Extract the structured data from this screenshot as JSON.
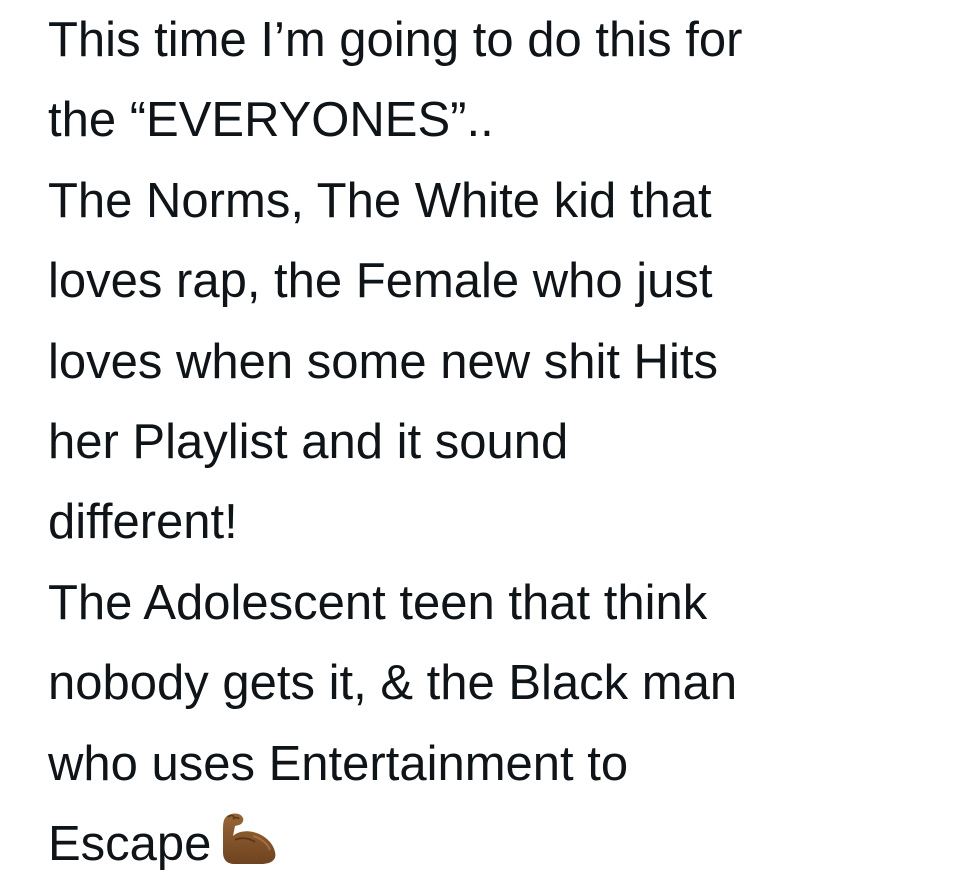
{
  "tweet": {
    "lines": [
      "This time I’m going to do this for",
      "the “EVERYONES”..",
      "The Norms, The White kid that",
      "loves rap, the Female who just",
      "loves when some new shit Hits",
      "her Playlist and it sound",
      "different!",
      "The Adolescent teen that think",
      "nobody gets it, & the Black man",
      "who uses Entertainment to",
      "Escape"
    ],
    "emoji": {
      "name": "flexed-biceps-medium-dark-skin-tone",
      "color": "#8a5a2b"
    }
  }
}
